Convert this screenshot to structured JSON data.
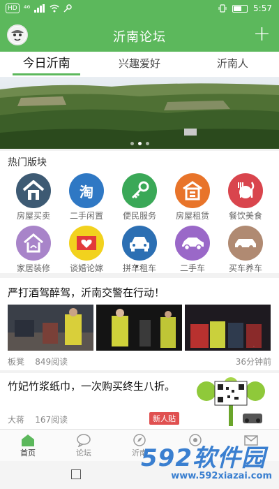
{
  "status_bar": {
    "left_badges": [
      "HD",
      "⁴⁶"
    ],
    "time": "5:57"
  },
  "app_bar": {
    "title": "沂南论坛",
    "plus_icon": "plus-icon"
  },
  "tabs": [
    {
      "label": "今日沂南",
      "active": true
    },
    {
      "label": "兴趣爱好",
      "active": false
    },
    {
      "label": "沂南人",
      "active": false
    }
  ],
  "banner": {
    "pages": 3,
    "current": 1
  },
  "hot_sections": {
    "title": "热门版块",
    "items": [
      {
        "label": "房屋买卖",
        "icon": "house-icon",
        "color": "#3d5a73"
      },
      {
        "label": "二手闲置",
        "icon": "tao-icon",
        "color": "#2f78c4",
        "glyph": "淘"
      },
      {
        "label": "便民服务",
        "icon": "key-icon",
        "color": "#3aa857"
      },
      {
        "label": "房屋租赁",
        "icon": "house-rent-icon",
        "color": "#e8742a"
      },
      {
        "label": "餐饮美食",
        "icon": "dining-icon",
        "color": "#d9454d"
      },
      {
        "label": "家居装修",
        "icon": "home-decor-icon",
        "color": "#a884c9"
      },
      {
        "label": "谈婚论嫁",
        "icon": "wedding-icon",
        "color": "#f2d21e"
      },
      {
        "label": "拼车租车",
        "icon": "car-front-icon",
        "color": "#2c6fb3"
      },
      {
        "label": "二手车",
        "icon": "car-side-icon",
        "color": "#9a68c8"
      },
      {
        "label": "买车养车",
        "icon": "car-care-icon",
        "color": "#b08a72"
      }
    ],
    "pages": 2,
    "current": 1
  },
  "posts": [
    {
      "title": "严打酒驾醉驾，沂南交警在行动！",
      "author": "板凳",
      "views": "849阅读",
      "time": "36分钟前"
    },
    {
      "title": "竹妃竹浆纸巾，一次购买终生八折。",
      "author": "大蒋",
      "views": "167阅读",
      "badge": "新人贴"
    }
  ],
  "bottom_nav": [
    {
      "label": "首页",
      "icon": "home-icon",
      "active": true
    },
    {
      "label": "论坛",
      "icon": "chat-bubble-icon",
      "active": false
    },
    {
      "label": "沂南",
      "icon": "compass-icon",
      "active": false
    },
    {
      "label": "",
      "icon": "eye-icon",
      "active": false
    },
    {
      "label": "",
      "icon": "message-icon",
      "active": false
    }
  ],
  "watermark": {
    "big": "592软件园",
    "small": "www.592xiazai.com"
  },
  "colors": {
    "brand_green": "#5cb85c",
    "badge_red": "#e05050",
    "watermark_blue": "#3a7fd0"
  }
}
